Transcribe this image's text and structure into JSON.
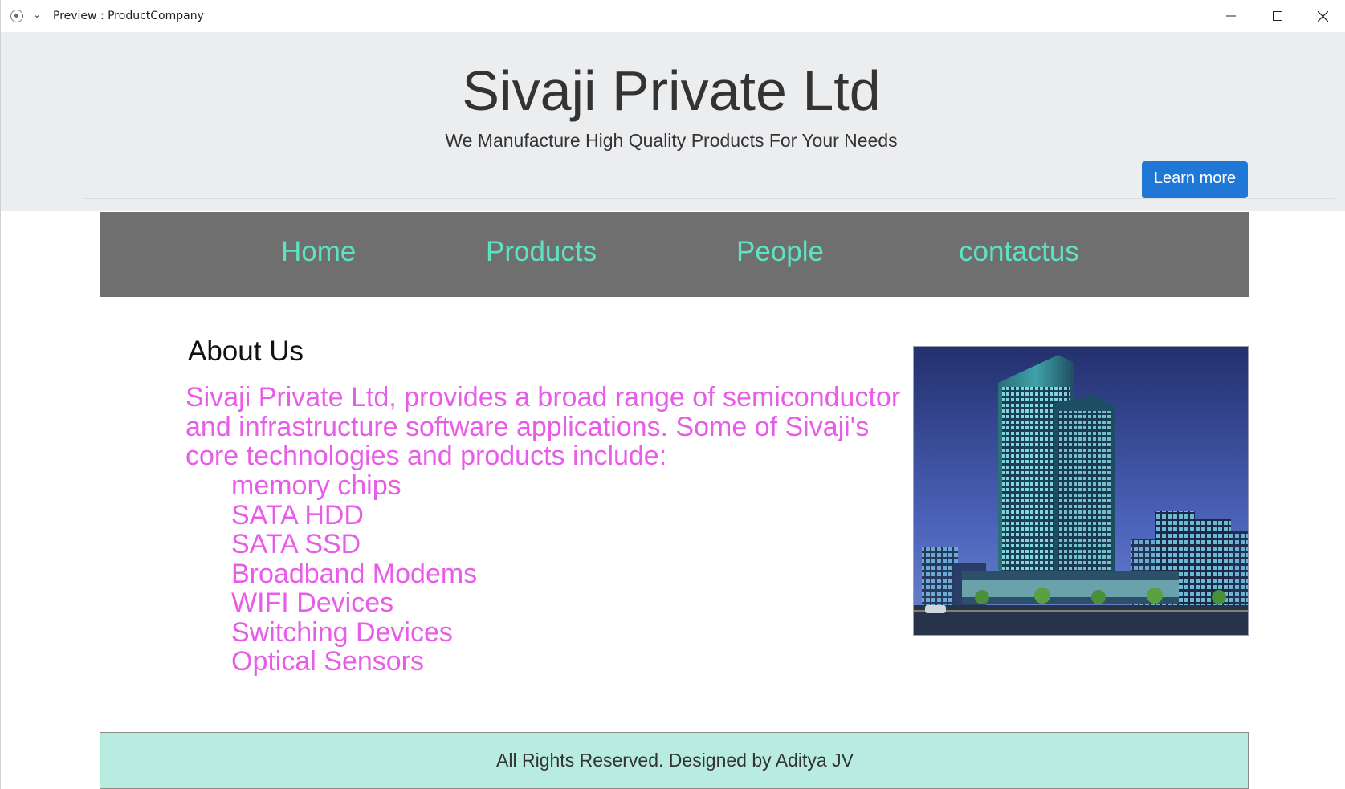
{
  "window": {
    "title": "Preview : ProductCompany"
  },
  "header": {
    "title": "Sivaji Private Ltd",
    "subtitle": "We Manufacture High Quality Products For Your Needs",
    "learn_more_label": "Learn more"
  },
  "nav": {
    "items": [
      {
        "label": "Home"
      },
      {
        "label": "Products"
      },
      {
        "label": "People"
      },
      {
        "label": "contactus"
      }
    ]
  },
  "about": {
    "heading": "About Us",
    "intro": "Sivaji Private Ltd, provides a broad range of semiconductor and infrastructure software applications. Some of Sivaji's core technologies and products include:",
    "products": [
      "memory chips",
      "SATA HDD",
      "SATA SSD",
      "Broadband Modems",
      "WIFI Devices",
      "Switching Devices",
      "Optical Sensors"
    ]
  },
  "footer": {
    "text": "All Rights Reserved. Designed by Aditya JV"
  },
  "colors": {
    "jumbotron_bg": "#ecedef",
    "nav_bg": "#6f6f6f",
    "nav_text": "#5ee3c2",
    "content_text": "#e85ce8",
    "button_bg": "#1f78d6",
    "footer_bg": "#b8ece0"
  }
}
